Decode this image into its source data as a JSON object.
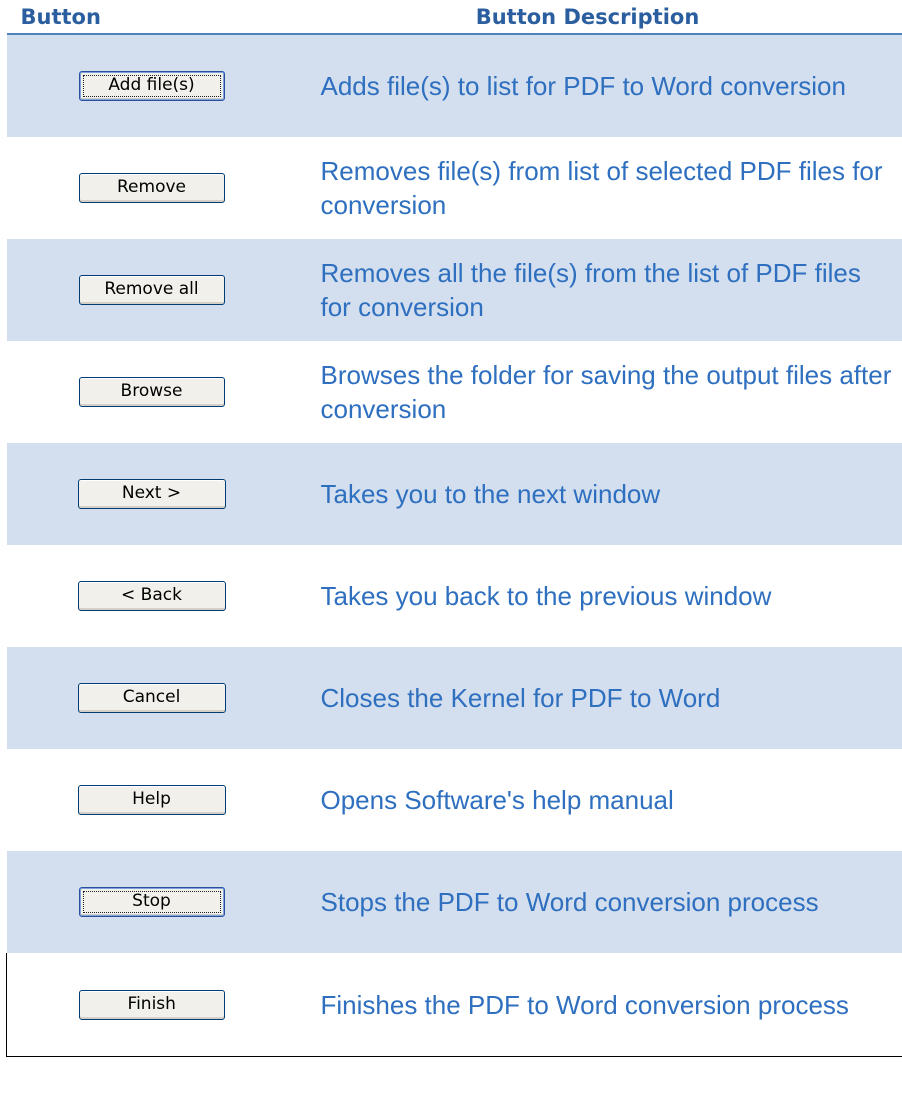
{
  "header": {
    "col_button": "Button",
    "col_description": "Button Description"
  },
  "rows": [
    {
      "button_label": "Add file(s)",
      "description": "Adds file(s) to list for PDF to Word conversion"
    },
    {
      "button_label": "Remove",
      "description": "Removes file(s) from list of selected PDF files for conversion"
    },
    {
      "button_label": "Remove all",
      "description": "Removes all the file(s) from the list of PDF files for conversion"
    },
    {
      "button_label": "Browse",
      "description": "Browses the folder for saving the output files after conversion"
    },
    {
      "button_label": "Next >",
      "description": "Takes you to the next window"
    },
    {
      "button_label": "< Back",
      "description": "Takes you back to the previous window"
    },
    {
      "button_label": "Cancel",
      "description": "Closes the Kernel for PDF to Word"
    },
    {
      "button_label": "Help",
      "description": "Opens Software's help manual"
    },
    {
      "button_label": "Stop",
      "description": "Stops the PDF to Word conversion process"
    },
    {
      "button_label": "Finish",
      "description": "Finishes the PDF to Word conversion process"
    }
  ],
  "colors": {
    "header_text": "#2a5e9f",
    "description_text": "#2e6fbf",
    "shaded_row": "#d3dfee",
    "header_rule": "#4f81bd"
  }
}
